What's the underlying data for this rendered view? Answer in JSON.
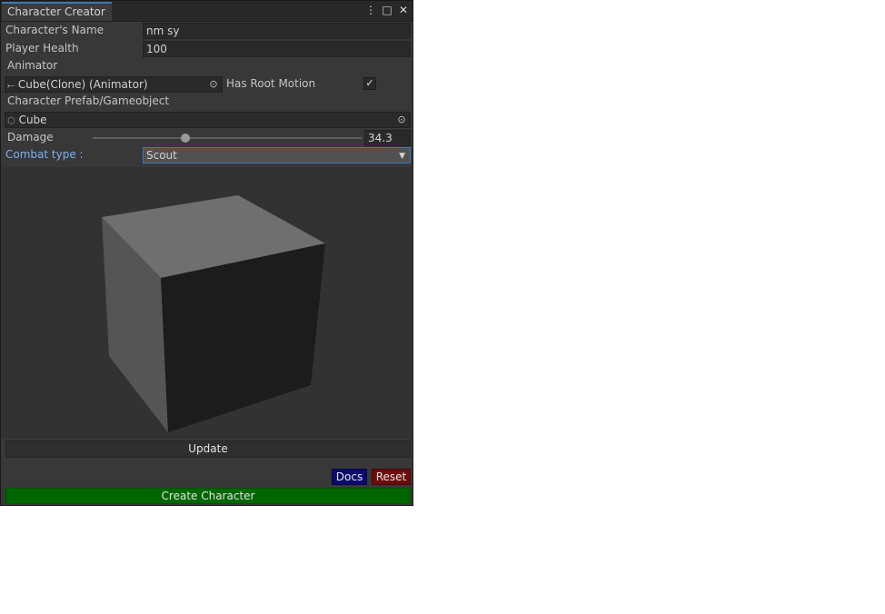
{
  "window": {
    "tab_title": "Character Creator",
    "icons": [
      "kebab-menu-icon",
      "maximize-icon",
      "close-icon"
    ],
    "menu_glyph": "⋮",
    "maximize_glyph": "□",
    "close_glyph": "✕"
  },
  "form": {
    "name_label": "Character's Name",
    "name_value": "nm sy",
    "health_label": "Player Health",
    "health_value": "100",
    "animator_label": "Animator",
    "animator_value": "Cube(Clone) (Animator)",
    "animator_icon_glyph": "⤚",
    "target_glyph": "⊙",
    "root_motion_label": "Has Root Motion",
    "root_motion_checked": true,
    "check_glyph": "✓",
    "prefab_label": "Character Prefab/Gameobject",
    "prefab_value": "Cube",
    "prefab_icon_glyph": "⬡",
    "damage_label": "Damage",
    "damage_value": "34.3",
    "damage_fraction": 0.343,
    "combat_label": "Combat type :",
    "combat_value": "Scout",
    "caret_glyph": "▼"
  },
  "buttons": {
    "update": "Update",
    "docs": "Docs",
    "reset": "Reset",
    "create": "Create Character"
  },
  "colors": {
    "window_bg": "#383838",
    "accent_blue": "#3a79bb",
    "combat_label_color": "#7fb0ee",
    "docs_bg": "#0b0b6e",
    "reset_bg": "#6e0b0b",
    "create_bg": "#006600"
  }
}
